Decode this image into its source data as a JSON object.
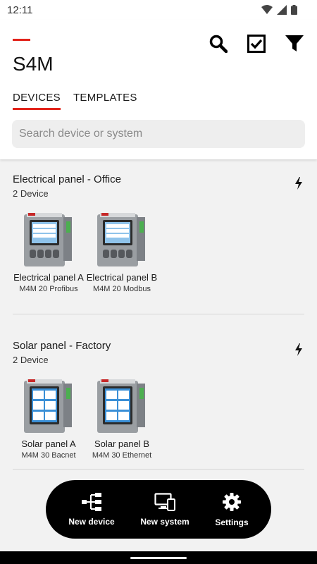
{
  "status_bar": {
    "time": "12:11"
  },
  "app": {
    "title": "S4M",
    "brand_color": "#e2231a"
  },
  "header_actions": [
    {
      "name": "search-icon"
    },
    {
      "name": "select-checkbox-icon"
    },
    {
      "name": "filter-icon"
    }
  ],
  "tabs": [
    {
      "label": "DEVICES",
      "active": true
    },
    {
      "label": "TEMPLATES",
      "active": false
    }
  ],
  "search": {
    "placeholder": "Search device or system",
    "value": ""
  },
  "groups": [
    {
      "title": "Electrical panel - Office",
      "count": "2 Device",
      "icon": "lightning-icon",
      "devices": [
        {
          "name": "Electrical panel A",
          "model": "M4M 20 Profibus",
          "screen": "list"
        },
        {
          "name": "Electrical panel B",
          "model": "M4M 20 Modbus",
          "screen": "list"
        }
      ]
    },
    {
      "title": "Solar panel - Factory",
      "count": "2 Device",
      "icon": "lightning-icon",
      "devices": [
        {
          "name": "Solar panel A",
          "model": "M4M 30 Bacnet",
          "screen": "grid"
        },
        {
          "name": "Solar panel B",
          "model": "M4M 30 Ethernet",
          "screen": "grid"
        }
      ]
    }
  ],
  "bottom_actions": [
    {
      "label": "New device",
      "icon": "device-tree-icon"
    },
    {
      "label": "New system",
      "icon": "monitor-phone-icon"
    },
    {
      "label": "Settings",
      "icon": "gear-icon"
    }
  ]
}
